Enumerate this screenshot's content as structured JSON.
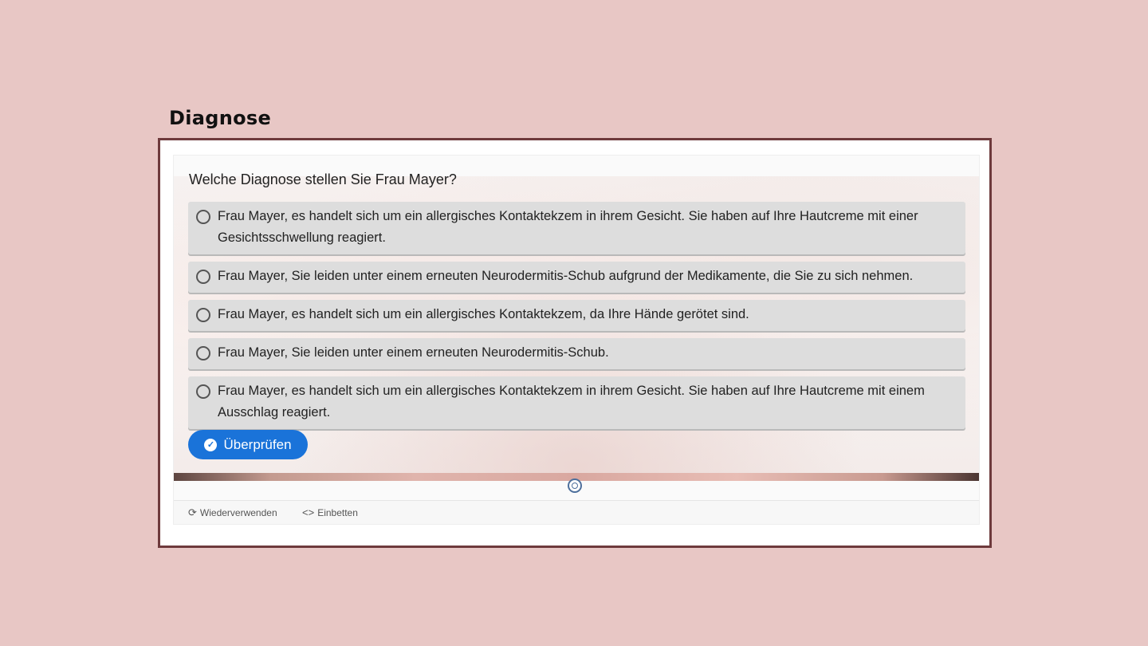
{
  "slide": {
    "title": "Diagnose"
  },
  "quiz": {
    "question": "Welche Diagnose stellen Sie Frau Mayer?",
    "options": [
      "Frau Mayer, es handelt sich um ein allergisches Kontaktekzem in ihrem Gesicht. Sie haben auf Ihre Hautcreme mit einer Gesichtsschwellung reagiert.",
      "Frau Mayer, Sie leiden unter einem erneuten Neurodermitis-Schub aufgrund der Medikamente, die Sie zu sich nehmen.",
      "Frau Mayer, es handelt sich um ein allergisches Kontaktekzem, da Ihre Hände gerötet sind.",
      "Frau Mayer, Sie leiden unter einem erneuten Neurodermitis-Schub.",
      "Frau Mayer, es handelt sich um ein allergisches Kontaktekzem in ihrem Gesicht. Sie haben auf Ihre Hautcreme mit einem Ausschlag reagiert."
    ],
    "check_label": "Überprüfen",
    "check_icon": "check-circle-icon"
  },
  "footer": {
    "reuse_label": "Wiederverwenden",
    "reuse_icon": "refresh-icon",
    "embed_label": "Einbetten",
    "embed_icon": "code-icon"
  },
  "colors": {
    "page_background": "#e8c7c5",
    "frame_border": "#6e3a3c",
    "option_background": "#dddddd",
    "button_background": "#1a73d9"
  }
}
